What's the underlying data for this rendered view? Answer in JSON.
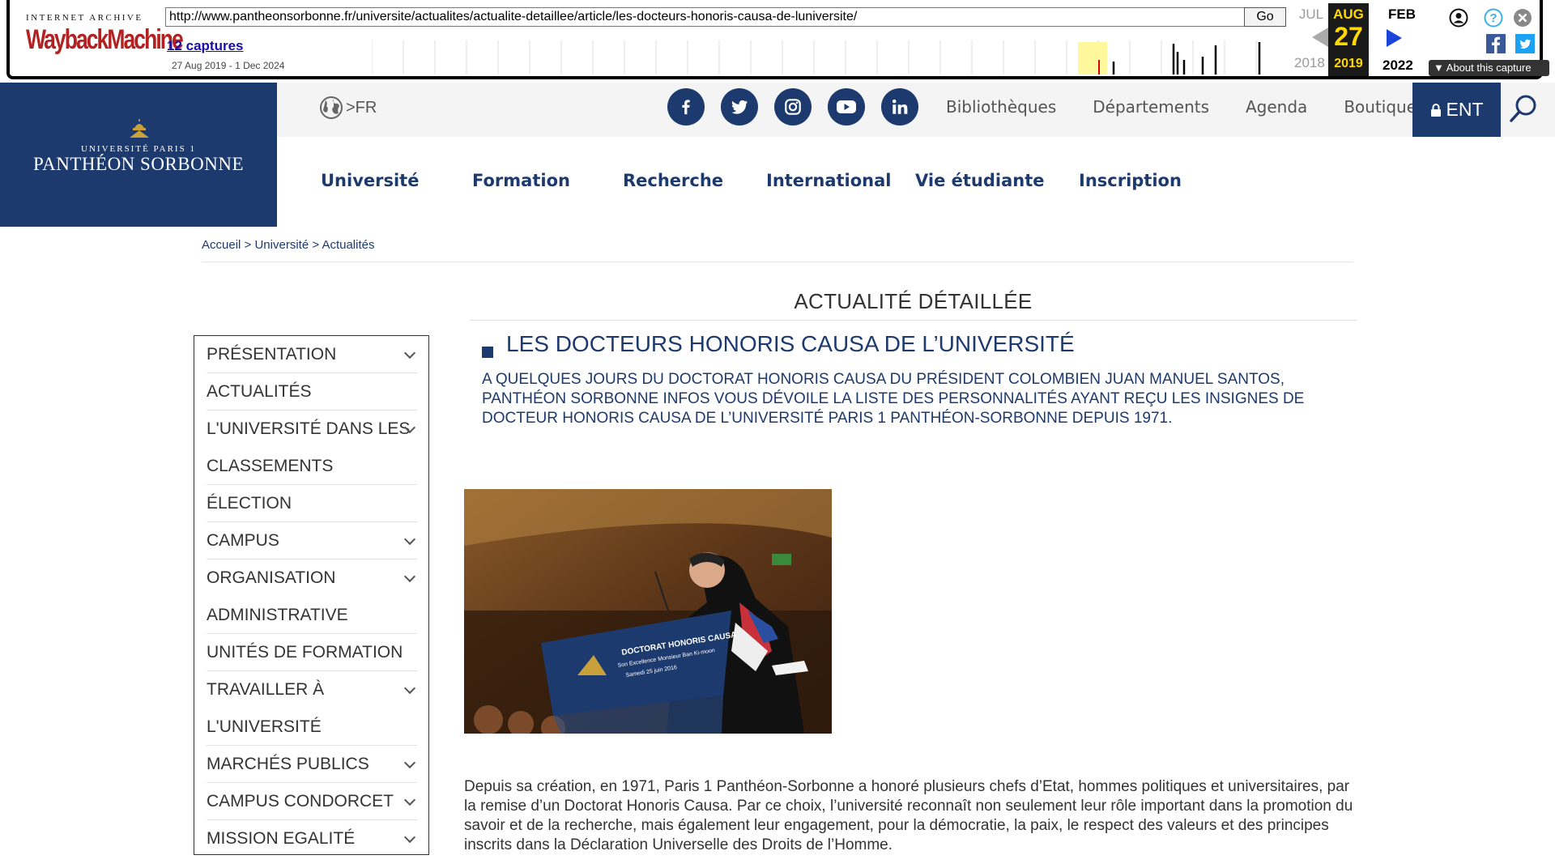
{
  "wayback": {
    "logo_top": "INTERNET ARCHIVE",
    "logo_wayback": "Wayback",
    "logo_machine": "Machine",
    "url": "http://www.pantheonsorbonne.fr/universite/actualites/actualite-detaillee/article/les-docteurs-honoris-causa-de-luniversite/",
    "go_label": "Go",
    "captures_label": "12 captures",
    "date_range": "27 Aug 2019 - 1 Dec 2024",
    "prev_month": "JUL",
    "cur_month": "AUG",
    "next_month": "FEB",
    "cur_day": "27",
    "prev_year": "2018",
    "cur_year": "2019",
    "next_year": "2022",
    "about_label": "About this capture",
    "icons": [
      "account-icon",
      "help-icon",
      "close-icon",
      "facebook-icon",
      "twitter-icon"
    ]
  },
  "site": {
    "logo_small": "UNIVERSITÉ PARIS 1",
    "logo_big": "PANTHÉON SORBONNE",
    "lang_label": ">FR",
    "socials": [
      "facebook-icon",
      "twitter-icon",
      "instagram-icon",
      "youtube-icon",
      "linkedin-icon"
    ],
    "toplinks": [
      "Bibliothèques",
      "Départements",
      "Agenda",
      "Boutique"
    ],
    "ent_label": "ENT",
    "nav": [
      "Université",
      "Formation",
      "Recherche",
      "International",
      "Vie étudiante",
      "Inscription"
    ],
    "brand_color": "#1d3a6e"
  },
  "breadcrumb": {
    "items": [
      "Accueil",
      "Université",
      "Actualités"
    ],
    "separator": " > "
  },
  "section_title": "ACTUALITÉ DÉTAILLÉE",
  "sidebar": {
    "items": [
      {
        "label": "PRÉSENTATION",
        "has_children": true
      },
      {
        "label": "ACTUALITÉS",
        "has_children": false
      },
      {
        "label": "L'UNIVERSITÉ DANS LES",
        "label2": "CLASSEMENTS",
        "has_children": true
      },
      {
        "label": "ÉLECTION",
        "has_children": false
      },
      {
        "label": "CAMPUS",
        "has_children": true
      },
      {
        "label": "ORGANISATION",
        "label2": "ADMINISTRATIVE",
        "has_children": true
      },
      {
        "label": "UNITÉS DE FORMATION",
        "has_children": false
      },
      {
        "label": "TRAVAILLER À",
        "label2": "L'UNIVERSITÉ",
        "has_children": true
      },
      {
        "label": "MARCHÉS PUBLICS",
        "has_children": true
      },
      {
        "label": "CAMPUS CONDORCET",
        "has_children": true
      },
      {
        "label": "MISSION EGALITÉ",
        "has_children": true
      }
    ]
  },
  "article": {
    "title": "LES DOCTEURS HONORIS CAUSA DE L’UNIVERSITÉ",
    "lead": "A QUELQUES JOURS DU DOCTORAT HONORIS CAUSA DU PRÉSIDENT COLOMBIEN JUAN MANUEL SANTOS, PANTHÉON SORBONNE INFOS VOUS DÉVOILE LA LISTE DES PERSONNALITÉS AYANT REÇU LES INSIGNES DE DOCTEUR HONORIS CAUSA DE L’UNIVERSITÉ PARIS 1 PANTHÉON-SORBONNE DEPUIS 1971.",
    "photo_sign_line1": "DOCTORAT HONORIS CAUSA",
    "photo_sign_line2": "Son Excellence Monsieur Ban Ki-moon",
    "photo_sign_line3": "Samedi 25 juin 2016",
    "body": "Depuis sa création, en 1971, Paris 1 Panthéon-Sorbonne a honoré plusieurs chefs d’Etat, hommes politiques et universitaires, par la remise d’un Doctorat Honoris Causa. Par ce choix, l’université reconnaît non seulement leur rôle important dans la promotion du savoir et de la recherche, mais également leur engagement, pour la démocratie, la paix, le respect des valeurs et des principes inscrits dans la Déclaration Universelle des Droits de l’Homme."
  }
}
